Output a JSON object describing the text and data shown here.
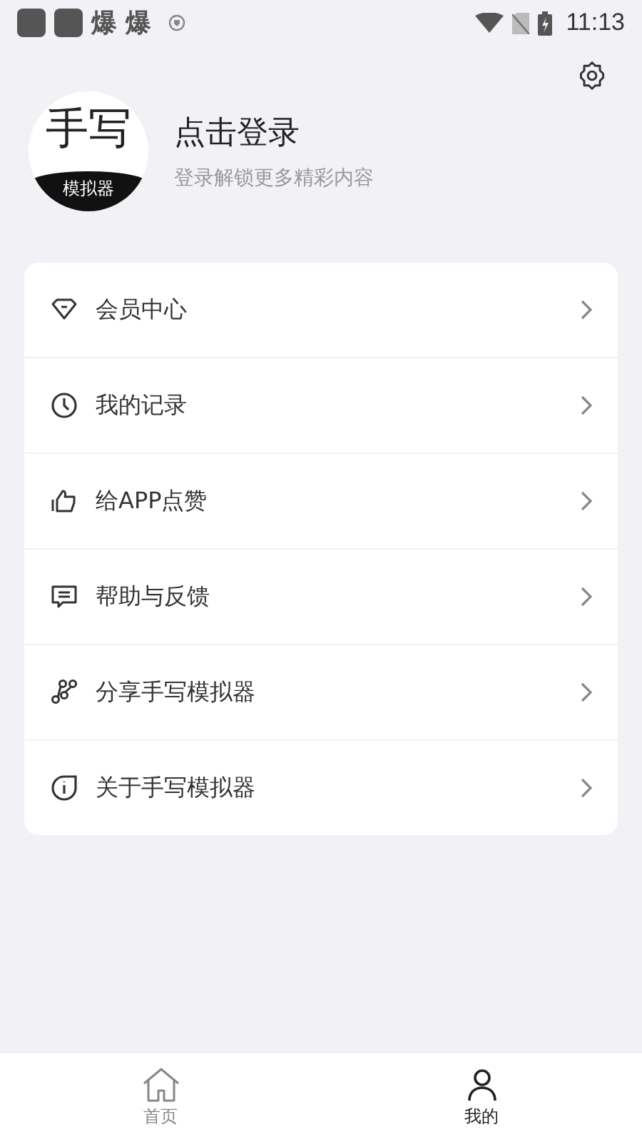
{
  "status_bar": {
    "notifications": [
      "爆",
      "爆"
    ],
    "time": "11:13"
  },
  "profile": {
    "logo_top": "手写",
    "logo_bottom": "模拟器",
    "title": "点击登录",
    "subtitle": "登录解锁更多精彩内容"
  },
  "menu": [
    {
      "label": "会员中心"
    },
    {
      "label": "我的记录"
    },
    {
      "label": "给APP点赞"
    },
    {
      "label": "帮助与反馈"
    },
    {
      "label": "分享手写模拟器"
    },
    {
      "label": "关于手写模拟器"
    }
  ],
  "tabs": [
    {
      "label": "首页",
      "selected": false
    },
    {
      "label": "我的",
      "selected": true
    }
  ]
}
